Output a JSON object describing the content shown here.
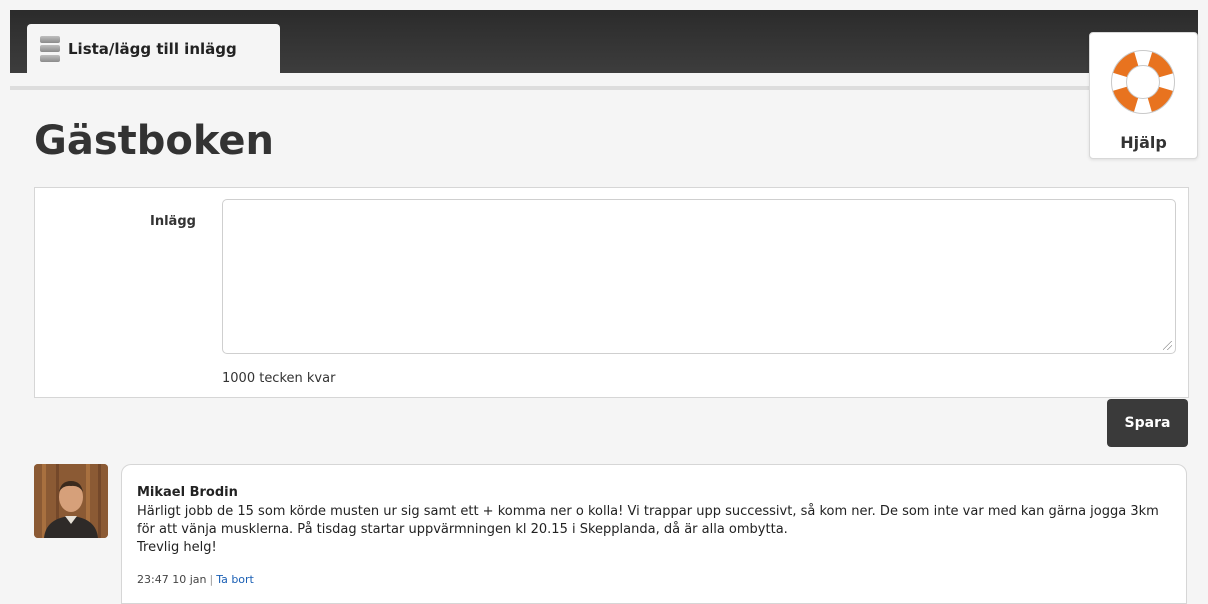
{
  "header": {
    "tab_label": "Lista/lägg till inlägg",
    "help_label": "Hjälp"
  },
  "page": {
    "title": "Gästboken"
  },
  "form": {
    "field_label": "Inlägg",
    "textarea_value": "",
    "char_count": "1000 tecken kvar",
    "save_label": "Spara"
  },
  "posts": [
    {
      "author": "Mikael Brodin",
      "line1": "Härligt jobb de 15 som körde musten ur sig samt ett + komma ner o kolla! Vi trappar upp successivt, så kom ner. De som inte var med kan gärna jogga 3km för att vänja musklerna. På tisdag startar uppvärmningen kl 20.15 i Skepplanda, då är alla ombytta.",
      "line2": "Trevlig helg!",
      "timestamp": "23:47 10 jan",
      "separator": "|",
      "delete_label": "Ta bort"
    }
  ],
  "colors": {
    "topbar": "#2b2b2b",
    "button": "#3a3a3a",
    "link": "#1a5fb4",
    "lifebuoy": "#e8731f"
  },
  "icons": {
    "tab": "database-icon",
    "help": "lifebuoy-icon"
  }
}
